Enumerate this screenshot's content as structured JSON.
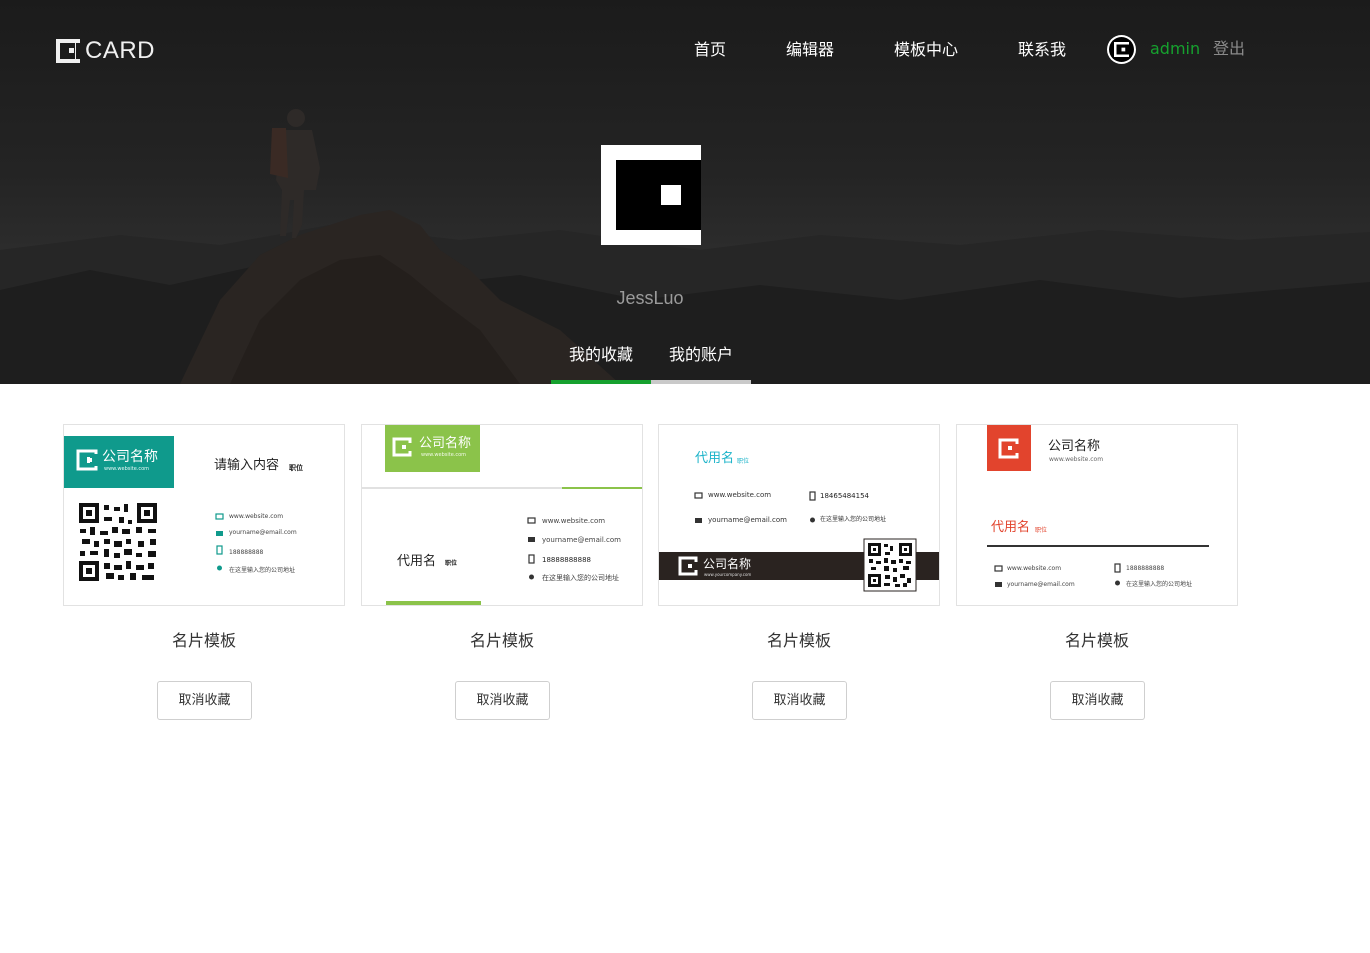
{
  "header": {
    "logo_text": "CARD",
    "nav": [
      {
        "label": "首页"
      },
      {
        "label": "编辑器"
      },
      {
        "label": "模板中心"
      },
      {
        "label": "联系我"
      }
    ],
    "user": {
      "name": "admin",
      "logout_label": "登出"
    }
  },
  "profile": {
    "name": "JessLuo",
    "tabs": [
      {
        "label": "我的收藏",
        "active": true
      },
      {
        "label": "我的账户",
        "active": false
      }
    ]
  },
  "colors": {
    "accent": "#16a12e",
    "teal": "#0f9a8c",
    "lime": "#8bc34a",
    "red": "#e2442d",
    "dark_band": "#2a2320",
    "text_cyan": "#1bb3c9"
  },
  "cards": [
    {
      "title": "名片模板",
      "unfav_label": "取消收藏",
      "preview": {
        "company": "公司名称",
        "company_url": "www.website.com",
        "headline": "请输入内容",
        "role": "职位",
        "website": "www.website.com",
        "email": "yourname@email.com",
        "phone": "188888888",
        "address": "在这里输入您的公司地址"
      }
    },
    {
      "title": "名片模板",
      "unfav_label": "取消收藏",
      "preview": {
        "company": "公司名称",
        "company_url": "www.website.com",
        "name": "代用名",
        "role": "职位",
        "website": "www.website.com",
        "email": "yourname@email.com",
        "phone": "18888888888",
        "address": "在这里输入您的公司地址"
      }
    },
    {
      "title": "名片模板",
      "unfav_label": "取消收藏",
      "preview": {
        "name": "代用名",
        "role": "职位",
        "website": "www.website.com",
        "phone": "18465484154",
        "email": "yourname@email.com",
        "address": "在这里输入您的公司地址",
        "company": "公司名称",
        "company_url": "www.yourcompany.com"
      }
    },
    {
      "title": "名片模板",
      "unfav_label": "取消收藏",
      "preview": {
        "company": "公司名称",
        "company_url": "www.website.com",
        "name": "代用名",
        "role": "职位",
        "website": "www.website.com",
        "phone": "1888888888",
        "email": "yourname@email.com",
        "address": "在这里输入您的公司地址"
      }
    }
  ]
}
